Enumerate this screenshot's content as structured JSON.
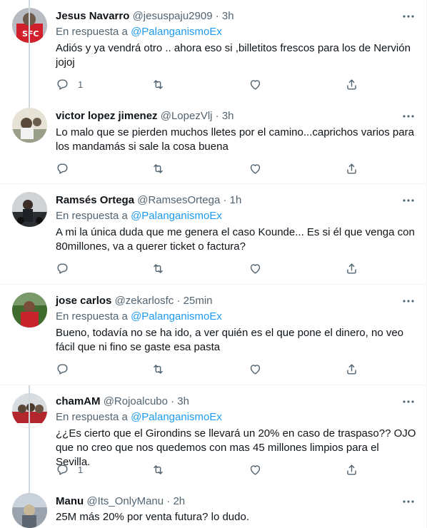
{
  "reply_prefix": "En respuesta a",
  "colors": {
    "accent": "#1d9bf0",
    "secondary": "#536471",
    "text": "#0f1419",
    "divider": "#eff3f4"
  },
  "tweets": [
    {
      "name": "Jesus Navarro",
      "handle": "@jesuspaju2909",
      "time": "· 3h",
      "reply_to": "@PalanganismoEx",
      "text": "Adiós y ya vendrá otro .. ahora eso si ,billetitos frescos para los de Nervión jojoj",
      "reply_count": "1",
      "avatar_colors": [
        "#b8bcc2",
        "#d11f2b"
      ]
    },
    {
      "name": "victor lopez jimenez",
      "handle": "@LopezVlj",
      "time": "· 3h",
      "reply_to": "",
      "text": "Lo malo que se pierden muchos lletes por el camino...caprichos varios para los mandamás si sale la cosa buena",
      "reply_count": "",
      "avatar_colors": [
        "#9a9f8a",
        "#e6e2d6"
      ]
    },
    {
      "name": "Ramsés Ortega",
      "handle": "@RamsesOrtega",
      "time": "· 1h",
      "reply_to": "@PalanganismoEx",
      "text": "A mi la única duda que me genera el caso Kounde... Es si él que venga con 80millones, va a querer ticket o factura?",
      "reply_count": "",
      "avatar_colors": [
        "#cfd3d6",
        "#2b2f33"
      ]
    },
    {
      "name": "jose carlos",
      "handle": "@zekarlosfc",
      "time": "· 25min",
      "reply_to": "@PalanganismoEx",
      "text": "Bueno, todavía no se ha ido, a ver quién es el que pone el dinero, no veo fácil que ni fino se gaste esa pasta",
      "reply_count": "",
      "avatar_colors": [
        "#3f6b2f",
        "#c8232c"
      ]
    },
    {
      "name": "chamAM",
      "handle": "@Rojoalcubo",
      "time": "· 3h",
      "reply_to": "@PalanganismoEx",
      "text": "¿¿Es cierto que el Girondins se llevará un 20% en caso de traspaso?? OJO que no creo que nos quedemos con mas 45 millones limpios para el Sevilla.",
      "reply_count": "1",
      "avatar_colors": [
        "#d8dde2",
        "#b3262d"
      ]
    },
    {
      "name": "Manu",
      "handle": "@Its_OnlyManu",
      "time": "· 2h",
      "reply_to": "",
      "text": "25M más 20% por venta futura? lo dudo.",
      "reply_count": "",
      "avatar_colors": [
        "#9aa3ad",
        "#c9b79a"
      ]
    }
  ]
}
